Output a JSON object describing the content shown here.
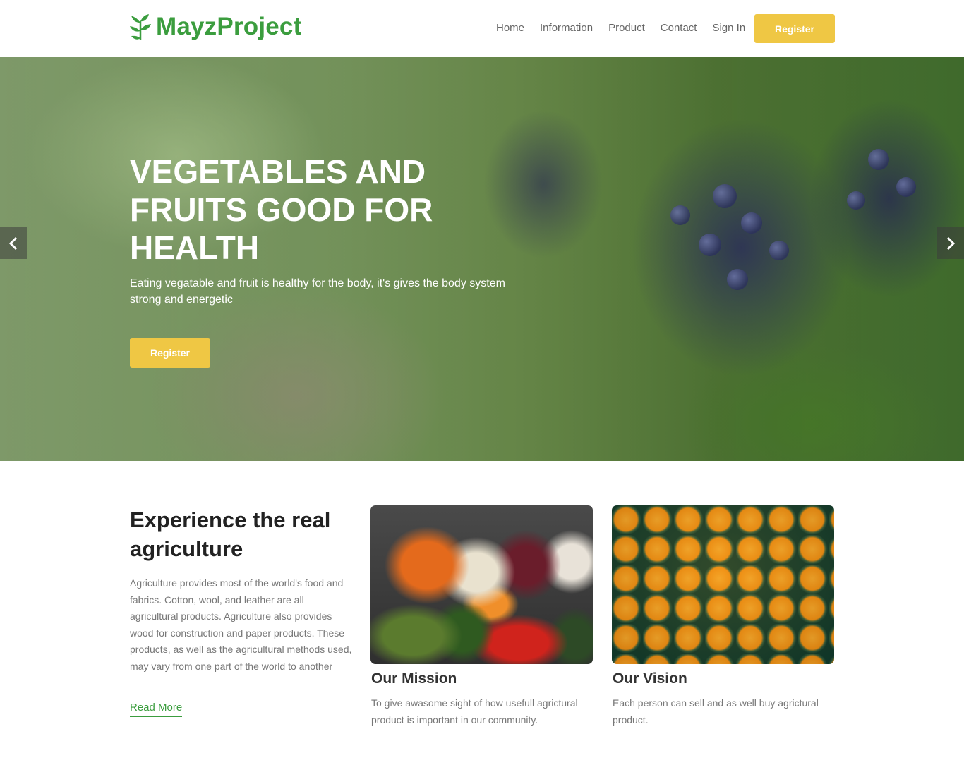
{
  "brand": {
    "name": "MayzProject",
    "color": "#3b9d3e",
    "icon": "leaf-icon"
  },
  "nav": {
    "items": [
      "Home",
      "Information",
      "Product",
      "Contact",
      "Sign In"
    ],
    "register_label": "Register",
    "accent": "#efc744"
  },
  "hero": {
    "title": "VEGETABLES AND FRUITS GOOD FOR HEALTH",
    "subtitle": "Eating vegatable and fruit is healthy for the body, it's gives the body system strong and energetic",
    "button_label": "Register",
    "prev_icon": "chevron-left-icon",
    "next_icon": "chevron-right-icon"
  },
  "about": {
    "title": "Experience the real agriculture",
    "text": "Agriculture provides most of the world's food and fabrics. Cotton, wool, and leather are all agricultural products. Agriculture also provides wood for construction and paper products. These products, as well as the agricultural methods used, may vary from one part of the world to another",
    "link_label": "Read More"
  },
  "cards": [
    {
      "title": "Our Mission",
      "text": "To give awasome sight of how usefull agrictural product is important in our community."
    },
    {
      "title": "Our Vision",
      "text": "Each person can sell and as well buy agrictural product."
    }
  ]
}
